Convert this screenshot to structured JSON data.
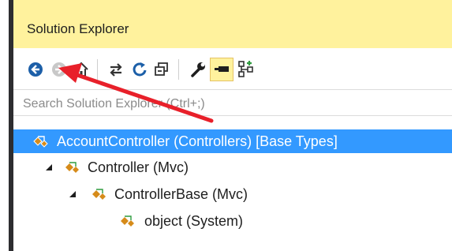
{
  "window": {
    "title": "Solution Explorer"
  },
  "toolbar": {
    "buttons": [
      {
        "name": "back-button",
        "icon": "back-arrow-icon"
      },
      {
        "name": "forward-button",
        "icon": "forward-arrow-icon",
        "disabled": true
      },
      {
        "name": "home-button",
        "icon": "home-icon"
      },
      {
        "name": "sync-with-document-button",
        "icon": "sync-arrows-icon"
      },
      {
        "name": "refresh-button",
        "icon": "refresh-icon"
      },
      {
        "name": "collapse-all-button",
        "icon": "collapse-all-icon"
      },
      {
        "name": "properties-button",
        "icon": "wrench-icon"
      },
      {
        "name": "preview-selected-button",
        "icon": "pin-icon",
        "active": true
      },
      {
        "name": "class-view-button",
        "icon": "class-diagram-icon"
      }
    ]
  },
  "search": {
    "placeholder": "Search Solution Explorer (Ctrl+;)",
    "value": ""
  },
  "tree": {
    "nodes": [
      {
        "label": "AccountController (Controllers) [Base Types]",
        "level": 0,
        "selected": true,
        "expanded": true,
        "icon": "class-hierarchy-icon"
      },
      {
        "label": "Controller (Mvc)",
        "level": 1,
        "selected": false,
        "expanded": true,
        "icon": "class-hierarchy-icon"
      },
      {
        "label": "ControllerBase (Mvc)",
        "level": 2,
        "selected": false,
        "expanded": true,
        "icon": "class-hierarchy-icon"
      },
      {
        "label": "object (System)",
        "level": 3,
        "selected": false,
        "expanded": false,
        "icon": "class-hierarchy-icon"
      }
    ]
  },
  "colors": {
    "title_bg": "#fff29d",
    "selection": "#3399ff",
    "annotation_arrow": "#e8202a",
    "icon_blue": "#1c5fa8",
    "icon_orange": "#d68b1a"
  }
}
